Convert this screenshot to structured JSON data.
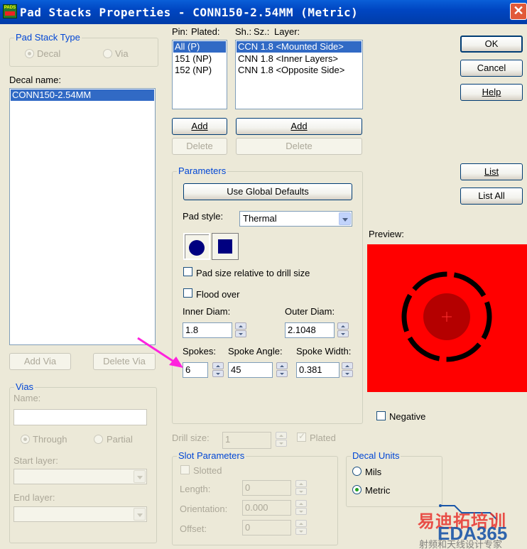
{
  "window": {
    "title": "Pad Stacks Properties - CONN150-2.54MM (Metric)",
    "icon_label": "PADS",
    "close_glyph": "✕",
    "accent_color": "#0054e3"
  },
  "pad_stack_type": {
    "legend": "Pad Stack Type",
    "decal": "Decal",
    "via": "Via",
    "selected": "Decal"
  },
  "decal_name": {
    "label": "Decal name:",
    "items": [
      "CONN150-2.54MM"
    ]
  },
  "add_via": "Add Via",
  "delete_via": "Delete Via",
  "vias": {
    "legend": "Vias",
    "name_label": "Name:",
    "through": "Through",
    "partial": "Partial",
    "start_layer": "Start layer:",
    "end_layer": "End layer:"
  },
  "pin_list": {
    "header_pin": "Pin:",
    "header_plated": "Plated:",
    "items": [
      "All (P)",
      "151 (NP)",
      "152 (NP)"
    ],
    "add": "Add",
    "delete": "Delete"
  },
  "layer_list": {
    "header_sh": "Sh.:",
    "header_sz": "Sz.:",
    "header_layer": "Layer:",
    "items": [
      "CCN 1.8 <Mounted Side>",
      "CNN 1.8 <Inner Layers>",
      "CNN 1.8 <Opposite Side>"
    ],
    "add": "Add",
    "delete": "Delete"
  },
  "buttons": {
    "ok": "OK",
    "cancel": "Cancel",
    "help": "Help",
    "list": "List",
    "list_all": "List All"
  },
  "parameters": {
    "legend": "Parameters",
    "use_global": "Use Global Defaults",
    "pad_style_label": "Pad style:",
    "pad_style_value": "Thermal",
    "relative_label": "Pad size relative to drill size",
    "flood_label": "Flood over",
    "inner_diam_label": "Inner Diam:",
    "inner_diam_value": "1.8",
    "outer_diam_label": "Outer Diam:",
    "outer_diam_value": "2.1048",
    "spokes_label": "Spokes:",
    "spokes_value": "6",
    "spoke_angle_label": "Spoke Angle:",
    "spoke_angle_value": "45",
    "spoke_width_label": "Spoke Width:",
    "spoke_width_value": "0.381"
  },
  "preview": {
    "label": "Preview:",
    "negative_label": "Negative",
    "bg_color": "#ff0000",
    "pad_color": "#b40000"
  },
  "drill": {
    "label": "Drill size:",
    "value": "1",
    "plated_label": "Plated"
  },
  "slot": {
    "legend": "Slot Parameters",
    "slotted": "Slotted",
    "length_label": "Length:",
    "length_value": "0",
    "orientation_label": "Orientation:",
    "orientation_value": "0.000",
    "offset_label": "Offset:",
    "offset_value": "0"
  },
  "units": {
    "legend": "Decal Units",
    "mils": "Mils",
    "metric": "Metric",
    "selected": "Metric"
  },
  "watermark": {
    "cn": "易迪拓培训",
    "eda": "EDA365",
    "sub": "射频和天线设计专家"
  }
}
